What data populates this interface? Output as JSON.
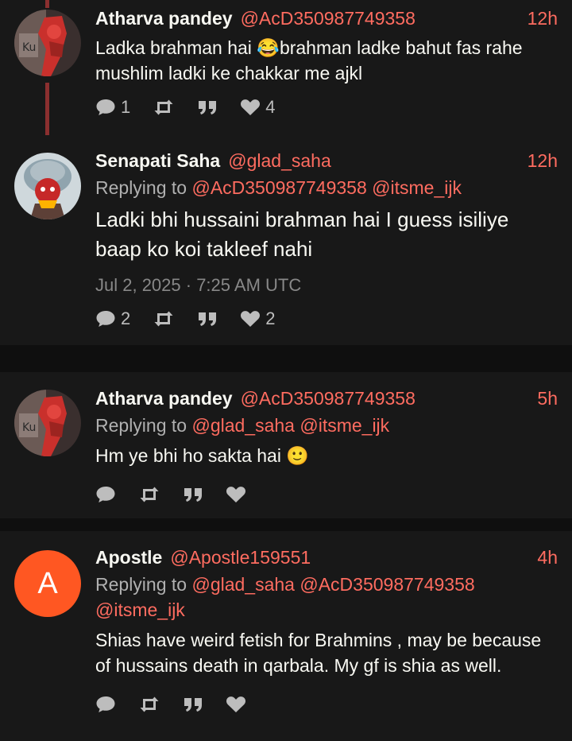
{
  "tweets": [
    {
      "fullname": "Atharva pandey",
      "username": "@AcD350987749358",
      "time": "12h",
      "text": "Ladka brahman hai 😂brahman ladke bahut fas rahe mushlim ladki ke chakkar me ajkl",
      "stats": {
        "comments": "1",
        "retweets": "",
        "quotes": "",
        "likes": "4"
      }
    },
    {
      "fullname": "Senapati Saha",
      "username": "@glad_saha",
      "time": "12h",
      "replying_label": "Replying to",
      "replying_to": "@AcD350987749358 @itsme_ijk",
      "text": "Ladki bhi hussaini brahman hai I guess isiliye baap ko koi takleef nahi",
      "date": "Jul 2, 2025 · 7:25 AM UTC",
      "stats": {
        "comments": "2",
        "retweets": "",
        "quotes": "",
        "likes": "2"
      }
    },
    {
      "fullname": "Atharva pandey",
      "username": "@AcD350987749358",
      "time": "5h",
      "replying_label": "Replying to",
      "replying_to": "@glad_saha @itsme_ijk",
      "text": "Hm ye bhi ho sakta hai 🙂",
      "stats": {
        "comments": "",
        "retweets": "",
        "quotes": "",
        "likes": ""
      }
    },
    {
      "fullname": "Apostle",
      "username": "@Apostle159551",
      "time": "4h",
      "avatar_letter": "A",
      "replying_label": "Replying to",
      "replying_to": "@glad_saha @AcD350987749358 @itsme_ijk",
      "text": "Shias have weird fetish for Brahmins , may be because of hussains death in qarbala. My gf is shia as well.",
      "stats": {
        "comments": "",
        "retweets": "",
        "quotes": "",
        "likes": ""
      }
    }
  ],
  "icons": {
    "comment": "comment-icon",
    "retweet": "retweet-icon",
    "quote": "quote-icon",
    "like": "heart-icon"
  },
  "colors": {
    "accent": "#ff6c60",
    "thread_line": "#8b2f2f",
    "letter_avatar": "#ff5722"
  }
}
